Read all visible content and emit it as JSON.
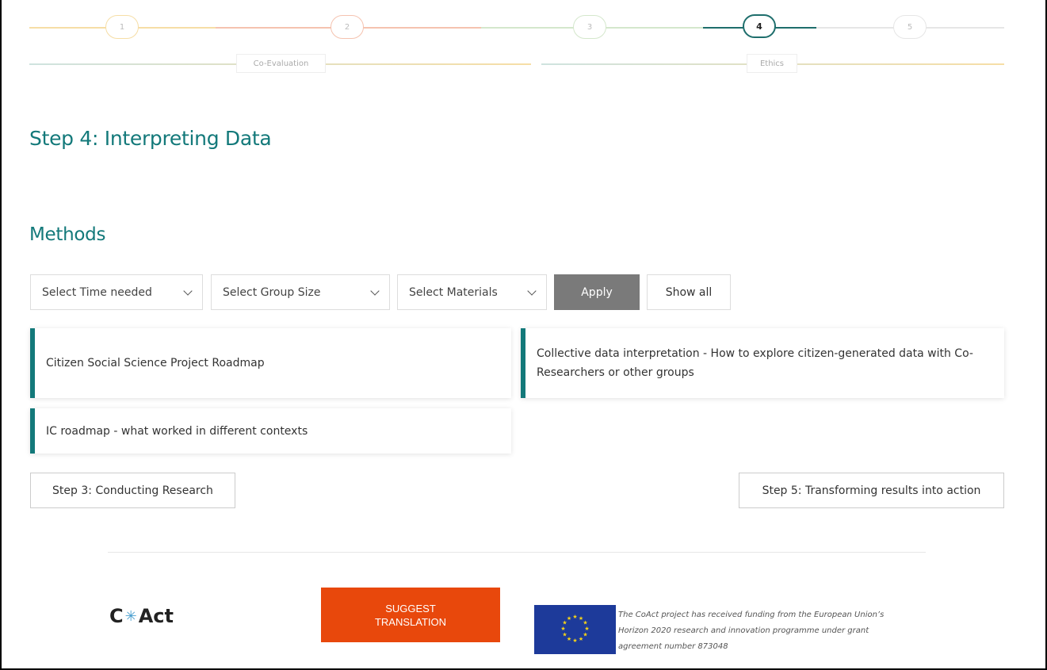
{
  "stepper": {
    "steps": [
      {
        "number": "1",
        "color": "#f6dea6"
      },
      {
        "number": "2",
        "color": "#f5c3b0"
      },
      {
        "number": "3",
        "color": "#d4e7cc"
      },
      {
        "number": "4",
        "color": "#1e6e6c",
        "active": true
      },
      {
        "number": "5",
        "color": "#e6e6e6"
      }
    ],
    "tags": [
      "Co-Evaluation",
      "Ethics"
    ]
  },
  "page": {
    "step_title": "Step 4: Interpreting Data",
    "methods_title": "Methods"
  },
  "filters": {
    "time": "Select Time needed",
    "group": "Select Group Size",
    "materials": "Select Materials",
    "apply": "Apply",
    "show_all": "Show all"
  },
  "methods": [
    "Citizen Social Science Project Roadmap",
    "Collective data interpretation - How to explore citizen-generated data with Co-Researchers or other groups",
    "IC roadmap - what worked in different contexts"
  ],
  "navigation": {
    "prev": "Step 3: Conducting Research",
    "next": "Step 5: Transforming results into action"
  },
  "footer": {
    "logo_left": "C",
    "logo_star": "✳",
    "logo_right": "Act",
    "suggest_line1": "SUGGEST",
    "suggest_line2": "TRANSLATION",
    "eu_text": "The CoAct project has received funding from the European Union’s Horizon 2020 research and innovation programme under grant agreement number 873048"
  }
}
